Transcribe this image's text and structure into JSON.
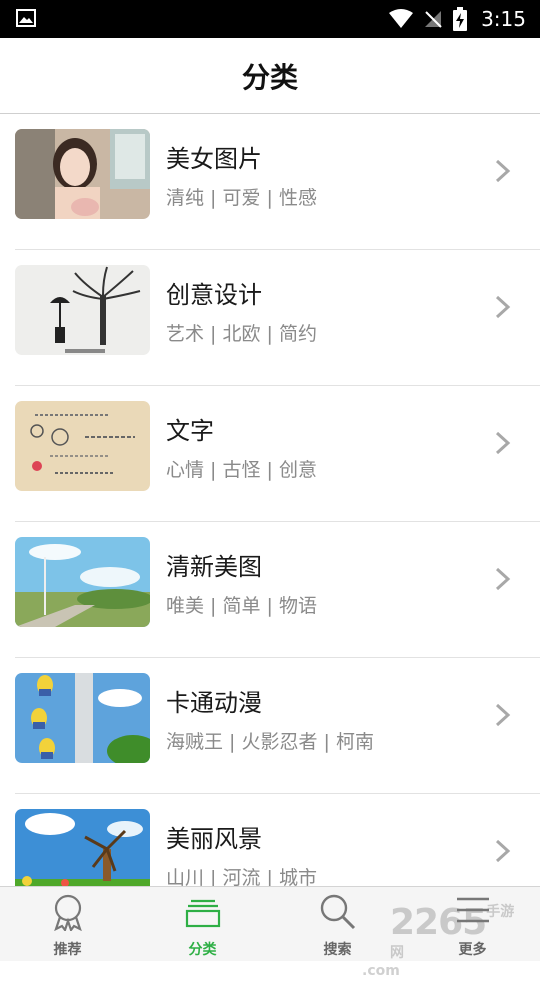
{
  "status_bar": {
    "time": "3:15"
  },
  "header": {
    "title": "分类"
  },
  "categories": [
    {
      "name": "美女图片",
      "tags": "清纯 | 可爱 | 性感"
    },
    {
      "name": "创意设计",
      "tags": "艺术 | 北欧 | 简约"
    },
    {
      "name": "文字",
      "tags": "心情 | 古怪 | 创意"
    },
    {
      "name": "清新美图",
      "tags": "唯美 | 简单 | 物语"
    },
    {
      "name": "卡通动漫",
      "tags": "海贼王 | 火影忍者 | 柯南"
    },
    {
      "name": "美丽风景",
      "tags": "山川 | 河流 | 城市"
    }
  ],
  "tabs": [
    {
      "label": "推荐",
      "icon": "badge-icon"
    },
    {
      "label": "分类",
      "icon": "category-icon"
    },
    {
      "label": "搜索",
      "icon": "search-icon"
    },
    {
      "label": "更多",
      "icon": "menu-icon"
    }
  ],
  "watermark": {
    "number": "2265",
    "cn": "手游网",
    "domain": ".com"
  },
  "colors": {
    "accent": "#2eaf45",
    "tag_text": "#8a8a8a",
    "status_bar": "#000000"
  }
}
